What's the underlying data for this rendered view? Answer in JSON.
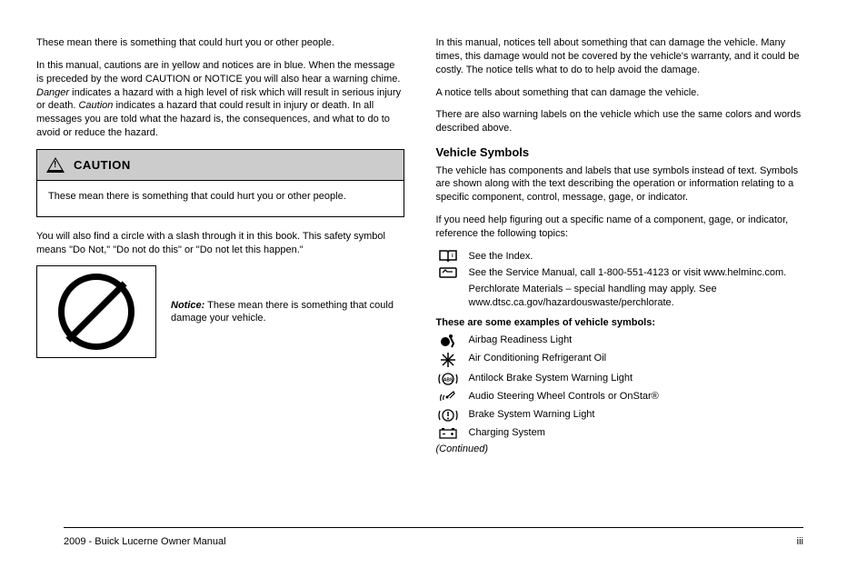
{
  "left": {
    "p1": "These mean there is something that could hurt you or other people.",
    "p2_part1": "In this manual, cautions are in yellow and notices are in blue. When the message is preceded by the word CAUTION or NOTICE you will also hear a warning chime. ",
    "p2_danger": "Danger",
    "p2_part2": " indicates a hazard with a high level of risk which will result in serious injury or death. ",
    "p2_caution": "Caution",
    "p2_part3": " indicates a hazard that could result in injury or death. In all messages you are told what the hazard is, the consequences, and what to do to avoid or reduce the hazard.",
    "caution_title": "CAUTION",
    "caution_body": "These mean there is something that could hurt you or other people.",
    "p3": "You will also find a circle with a slash through it in this book. This safety symbol means \"Do Not,\" \"Do not do this\" or \"Do not let this happen.\"",
    "notice_strong": "Notice:",
    "notice_text": " These mean there is something that could damage your vehicle."
  },
  "right": {
    "p1": "In this manual, notices tell about something that can damage the vehicle. Many times, this damage would not be covered by the vehicle's warranty, and it could be costly. The notice tells what to do to help avoid the damage.",
    "p2": "A notice tells about something that can damage the vehicle.",
    "p3": "There are also warning labels on the vehicle which use the same colors and words described above.",
    "h1": "Vehicle Symbols",
    "p4": "The vehicle has components and labels that use symbols instead of text. Symbols are shown along with the text describing the operation or information relating to a specific component, control, message, gage, or indicator.",
    "p5": "If you need help figuring out a specific name of a component, gage, or indicator, reference the following topics:",
    "syms": [
      {
        "label": "See the Index."
      },
      {
        "label": "See the Service Manual, call 1-800-551-4123 or visit www.helminc.com."
      },
      {
        "label": "Perchlorate Materials – special handling may apply. See www.dtsc.ca.gov/hazardouswaste/perchlorate."
      }
    ],
    "h2": "These are some examples of vehicle symbols:",
    "tbl": [
      {
        "label": "Airbag Readiness Light"
      },
      {
        "label": "Air Conditioning Refrigerant Oil"
      },
      {
        "label": "Antilock Brake System Warning Light"
      },
      {
        "label": "Audio Steering Wheel Controls or OnStar®"
      },
      {
        "label": "Brake System Warning Light"
      },
      {
        "label": "Charging System"
      }
    ],
    "cont": "(Continued)"
  },
  "footer": {
    "left": "2009 - Buick Lucerne Owner Manual",
    "right": "iii"
  }
}
